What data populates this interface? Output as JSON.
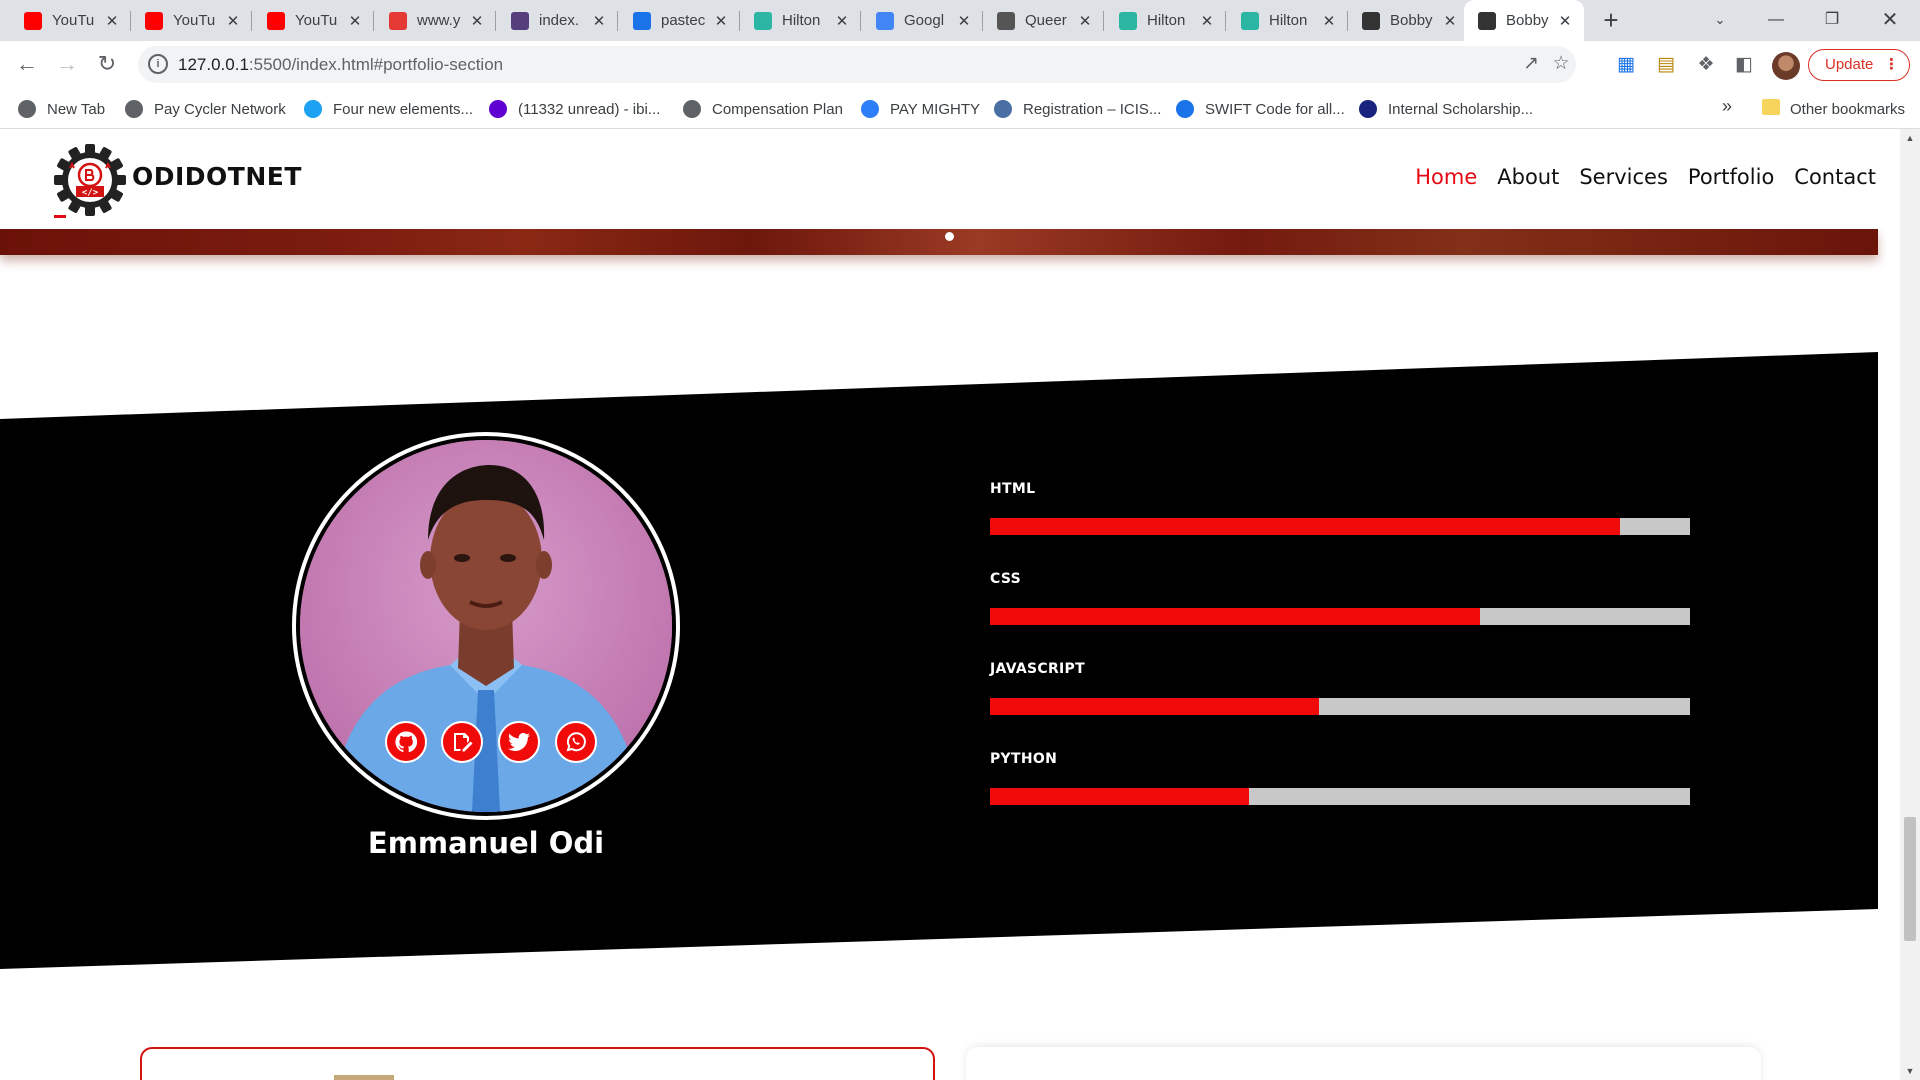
{
  "browser": {
    "tabs": [
      {
        "title": "YouTu",
        "icon": "youtube-icon",
        "color": "#ff0000"
      },
      {
        "title": "YouTu",
        "icon": "youtube-icon",
        "color": "#ff0000"
      },
      {
        "title": "YouTu",
        "icon": "youtube-icon",
        "color": "#ff0000"
      },
      {
        "title": "www.y",
        "icon": "download-icon",
        "color": "#e53935"
      },
      {
        "title": "index.",
        "icon": "bootstrap-icon",
        "color": "#563d7c"
      },
      {
        "title": "pastec",
        "icon": "paste-icon",
        "color": "#1a73e8"
      },
      {
        "title": "Hilton",
        "icon": "hilton-icon",
        "color": "#2bb6a3"
      },
      {
        "title": "Googl",
        "icon": "google-icon",
        "color": "#4285f4"
      },
      {
        "title": "Queer",
        "icon": "queer-icon",
        "color": "#555555"
      },
      {
        "title": "Hilton",
        "icon": "hilton-icon",
        "color": "#2bb6a3"
      },
      {
        "title": "Hilton",
        "icon": "hilton-icon",
        "color": "#2bb6a3"
      },
      {
        "title": "Bobby",
        "icon": "gear-logo-icon",
        "color": "#333333"
      },
      {
        "title": "Bobby",
        "icon": "gear-logo-icon",
        "color": "#333333",
        "active": true
      }
    ],
    "url_host": "127.0.0.1",
    "url_path": ":5500/index.html#portfolio-section",
    "update_label": "Update",
    "bookmarks": [
      {
        "label": "New Tab",
        "icon": "globe-icon",
        "color": "#5f6368"
      },
      {
        "label": "Pay Cycler Network",
        "icon": "globe-icon",
        "color": "#5f6368"
      },
      {
        "label": "Four new elements...",
        "icon": "blue-dot-icon",
        "color": "#1da1f2"
      },
      {
        "label": "(11332 unread) - ibi...",
        "icon": "yahoo-icon",
        "color": "#5f01d1"
      },
      {
        "label": "Compensation Plan",
        "icon": "globe-icon",
        "color": "#5f6368"
      },
      {
        "label": "PAY MIGHTY",
        "icon": "w-icon",
        "color": "#2d7ff9"
      },
      {
        "label": "Registration – ICIS...",
        "icon": "icis-icon",
        "color": "#4a6fa5"
      },
      {
        "label": "SWIFT Code for all...",
        "icon": "infinity-icon",
        "color": "#1a73e8"
      },
      {
        "label": "Internal Scholarship...",
        "icon": "scholarship-icon",
        "color": "#1a237e"
      }
    ],
    "other_bookmarks": "Other bookmarks"
  },
  "site": {
    "brand": "ODIDOTNET",
    "nav": [
      {
        "label": "Home",
        "active": true
      },
      {
        "label": "About"
      },
      {
        "label": "Services"
      },
      {
        "label": "Portfolio"
      },
      {
        "label": "Contact"
      }
    ],
    "profile": {
      "name": "Emmanuel Odi",
      "socials": [
        "github-icon",
        "edit-document-icon",
        "twitter-icon",
        "whatsapp-icon"
      ]
    },
    "skills": [
      {
        "label": "HTML",
        "percent": 90
      },
      {
        "label": "CSS",
        "percent": 70
      },
      {
        "label": "JAVASCRIPT",
        "percent": 47
      },
      {
        "label": "PYTHON",
        "percent": 37
      }
    ],
    "colors": {
      "accent": "#f00a0a",
      "nav_active": "#e50914",
      "section_bg": "#000000",
      "track": "#c8c8c8"
    }
  }
}
